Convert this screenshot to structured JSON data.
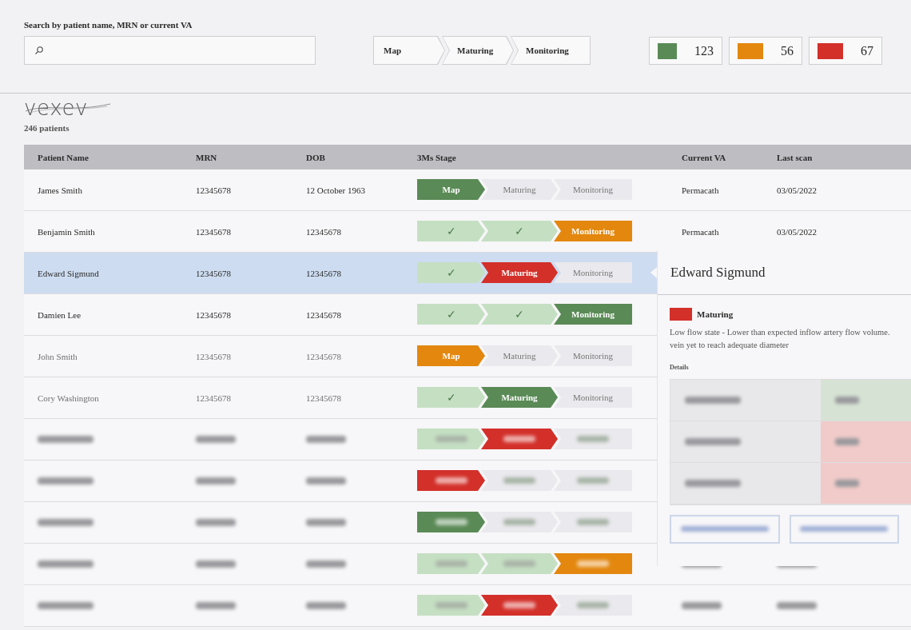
{
  "search": {
    "label": "Search by patient name, MRN or current VA"
  },
  "stage_filter": [
    {
      "label": "Map"
    },
    {
      "label": "Maturing"
    },
    {
      "label": "Monitoring"
    }
  ],
  "status_counts": [
    {
      "color": "#5a8a56",
      "count": "123"
    },
    {
      "color": "#e3870e",
      "count": "56"
    },
    {
      "color": "#d3302a",
      "count": "67"
    }
  ],
  "logo": "vexev",
  "patient_count": "246 patients",
  "table": {
    "columns": [
      "Patient Name",
      "MRN",
      "DOB",
      "3Ms Stage",
      "Current VA",
      "Last scan"
    ],
    "rows": [
      {
        "kind": "text",
        "name": "James Smith",
        "mrn": "12345678",
        "dob": "12 October 1963",
        "current_va": "Permacath",
        "last_scan": "03/05/2022",
        "selected": false,
        "faded": false,
        "stages": [
          {
            "kind": "current",
            "label": "Map",
            "color": "#5a8a56"
          },
          {
            "kind": "pending",
            "label": "Maturing"
          },
          {
            "kind": "pending",
            "label": "Monitoring"
          }
        ]
      },
      {
        "kind": "text",
        "name": "Benjamin Smith",
        "mrn": "12345678",
        "dob": "12345678",
        "current_va": "Permacath",
        "last_scan": "03/05/2022",
        "selected": false,
        "faded": false,
        "stages": [
          {
            "kind": "done",
            "label": "✓"
          },
          {
            "kind": "done",
            "label": "✓"
          },
          {
            "kind": "current",
            "label": "Monitoring",
            "color": "#e3870e"
          }
        ]
      },
      {
        "kind": "text",
        "name": "Edward Sigmund",
        "mrn": "12345678",
        "dob": "12345678",
        "selected": true,
        "faded": false,
        "stages": [
          {
            "kind": "done",
            "label": "✓"
          },
          {
            "kind": "current",
            "label": "Maturing",
            "color": "#d3302a"
          },
          {
            "kind": "pending",
            "label": "Monitoring"
          }
        ]
      },
      {
        "kind": "text",
        "name": "Damien Lee",
        "mrn": "12345678",
        "dob": "12345678",
        "selected": false,
        "faded": false,
        "stages": [
          {
            "kind": "done",
            "label": "✓"
          },
          {
            "kind": "done",
            "label": "✓"
          },
          {
            "kind": "current",
            "label": "Monitoring",
            "color": "#5a8a56"
          }
        ]
      },
      {
        "kind": "text",
        "name": "John Smith",
        "mrn": "12345678",
        "dob": "12345678",
        "selected": false,
        "faded": true,
        "stages": [
          {
            "kind": "current",
            "label": "Map",
            "color": "#e3870e"
          },
          {
            "kind": "pending",
            "label": "Maturing"
          },
          {
            "kind": "pending",
            "label": "Monitoring"
          }
        ]
      },
      {
        "kind": "text",
        "name": "Cory Washington",
        "mrn": "12345678",
        "dob": "12345678",
        "selected": false,
        "faded": true,
        "stages": [
          {
            "kind": "done",
            "label": "✓"
          },
          {
            "kind": "current",
            "label": "Maturing",
            "color": "#5a8a56"
          },
          {
            "kind": "pending",
            "label": "Monitoring"
          }
        ]
      },
      {
        "kind": "blurred",
        "selected": false,
        "stages": [
          {
            "kind": "done"
          },
          {
            "kind": "current",
            "color": "#d3302a"
          },
          {
            "kind": "pending"
          }
        ]
      },
      {
        "kind": "blurred",
        "selected": false,
        "stages": [
          {
            "kind": "current",
            "color": "#d3302a"
          },
          {
            "kind": "pending"
          },
          {
            "kind": "pending"
          }
        ]
      },
      {
        "kind": "blurred",
        "selected": false,
        "stages": [
          {
            "kind": "current",
            "color": "#5a8a56"
          },
          {
            "kind": "pending"
          },
          {
            "kind": "pending"
          }
        ]
      },
      {
        "kind": "blurred",
        "selected": false,
        "scan_columns_shown": true,
        "stages": [
          {
            "kind": "done"
          },
          {
            "kind": "done"
          },
          {
            "kind": "current",
            "color": "#e3870e"
          }
        ]
      },
      {
        "kind": "blurred",
        "selected": false,
        "scan_columns_shown": true,
        "stages": [
          {
            "kind": "done"
          },
          {
            "kind": "current",
            "color": "#d3302a"
          },
          {
            "kind": "pending"
          }
        ]
      }
    ]
  },
  "detail_panel": {
    "title": "Edward Sigmund",
    "status": {
      "label": "Maturing",
      "color": "#d3302a"
    },
    "description_lines": [
      "Low flow state - Lower than expected inflow artery flow volume.",
      "vein yet to reach adequate diameter"
    ],
    "details_label": "Details",
    "detail_rows": [
      {
        "color": "#d6e3d4"
      },
      {
        "color": "#f0cbc9"
      },
      {
        "color": "#f0cbc9"
      }
    ]
  }
}
